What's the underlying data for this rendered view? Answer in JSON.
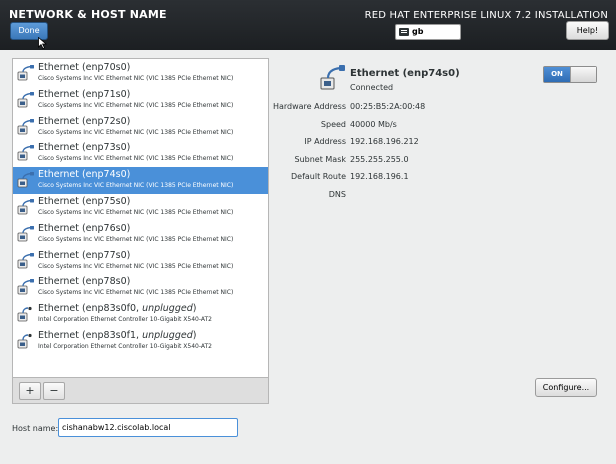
{
  "header": {
    "title": "NETWORK & HOST NAME",
    "done_label": "Done",
    "install_title": "RED HAT ENTERPRISE LINUX 7.2 INSTALLATION",
    "keyboard_layout": "gb",
    "help_label": "Help!"
  },
  "devices": [
    {
      "name": "Ethernet (enp70s0)",
      "state": "",
      "desc": "Cisco Systems Inc VIC Ethernet NIC (VIC 1385 PCIe Ethernet NIC)"
    },
    {
      "name": "Ethernet (enp71s0)",
      "state": "",
      "desc": "Cisco Systems Inc VIC Ethernet NIC (VIC 1385 PCIe Ethernet NIC)"
    },
    {
      "name": "Ethernet (enp72s0)",
      "state": "",
      "desc": "Cisco Systems Inc VIC Ethernet NIC (VIC 1385 PCIe Ethernet NIC)"
    },
    {
      "name": "Ethernet (enp73s0)",
      "state": "",
      "desc": "Cisco Systems Inc VIC Ethernet NIC (VIC 1385 PCIe Ethernet NIC)"
    },
    {
      "name": "Ethernet (enp74s0)",
      "state": "",
      "desc": "Cisco Systems Inc VIC Ethernet NIC (VIC 1385 PCIe Ethernet NIC)",
      "selected": true
    },
    {
      "name": "Ethernet (enp75s0)",
      "state": "",
      "desc": "Cisco Systems Inc VIC Ethernet NIC (VIC 1385 PCIe Ethernet NIC)"
    },
    {
      "name": "Ethernet (enp76s0)",
      "state": "",
      "desc": "Cisco Systems Inc VIC Ethernet NIC (VIC 1385 PCIe Ethernet NIC)"
    },
    {
      "name": "Ethernet (enp77s0)",
      "state": "",
      "desc": "Cisco Systems Inc VIC Ethernet NIC (VIC 1385 PCIe Ethernet NIC)"
    },
    {
      "name": "Ethernet (enp78s0)",
      "state": "",
      "desc": "Cisco Systems Inc VIC Ethernet NIC (VIC 1385 PCIe Ethernet NIC)"
    },
    {
      "name": "Ethernet (enp83s0f0, ",
      "state": "unplugged",
      "desc": "Intel Corporation Ethernet Controller 10-Gigabit X540-AT2"
    },
    {
      "name": "Ethernet (enp83s0f1, ",
      "state": "unplugged",
      "desc": "Intel Corporation Ethernet Controller 10-Gigabit X540-AT2"
    }
  ],
  "toolbar": {
    "add_label": "+",
    "remove_label": "−"
  },
  "hostname": {
    "label": "Host name:",
    "value": "cishanabw12.ciscolab.local"
  },
  "detail": {
    "name": "Ethernet (enp74s0)",
    "status": "Connected",
    "toggle_label": "ON",
    "properties": [
      {
        "label": "Hardware Address",
        "value": "00:25:B5:2A:00:48"
      },
      {
        "label": "Speed",
        "value": "40000 Mb/s"
      },
      {
        "label": "IP Address",
        "value": "192.168.196.212"
      },
      {
        "label": "Subnet Mask",
        "value": "255.255.255.0"
      },
      {
        "label": "Default Route",
        "value": "192.168.196.1"
      },
      {
        "label": "DNS",
        "value": ""
      }
    ],
    "configure_label": "Configure..."
  },
  "colors": {
    "accent": "#4a90d9",
    "header_bg": "#1c1f22",
    "page_bg": "#edeeee"
  }
}
